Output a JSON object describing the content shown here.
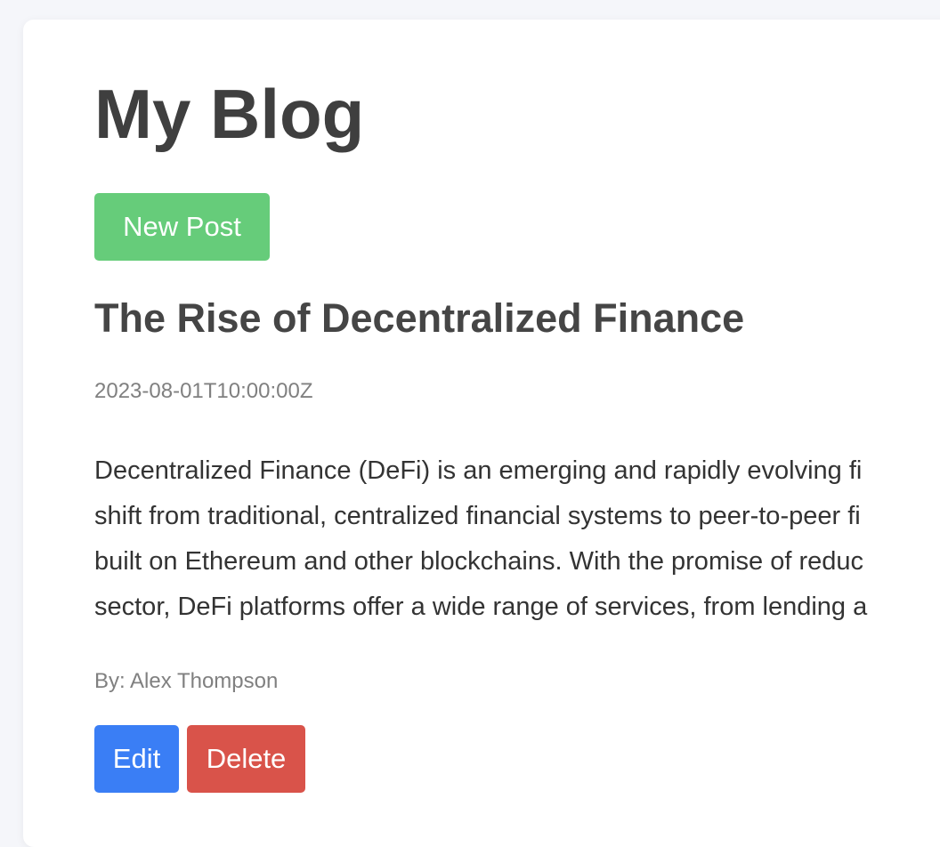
{
  "blog": {
    "title": "My Blog",
    "new_post_label": "New Post"
  },
  "post": {
    "title": "The Rise of Decentralized Finance",
    "date": "2023-08-01T10:00:00Z",
    "body_lines": [
      "Decentralized Finance (DeFi) is an emerging and rapidly evolving fi",
      "shift from traditional, centralized financial systems to peer-to-peer fi",
      "built on Ethereum and other blockchains. With the promise of reduc",
      "sector, DeFi platforms offer a wide range of services, from lending a"
    ],
    "author": "By: Alex Thompson",
    "edit_label": "Edit",
    "delete_label": "Delete"
  },
  "colors": {
    "new_post": "#66cc7a",
    "edit": "#3a7ef5",
    "delete": "#d9534a"
  }
}
